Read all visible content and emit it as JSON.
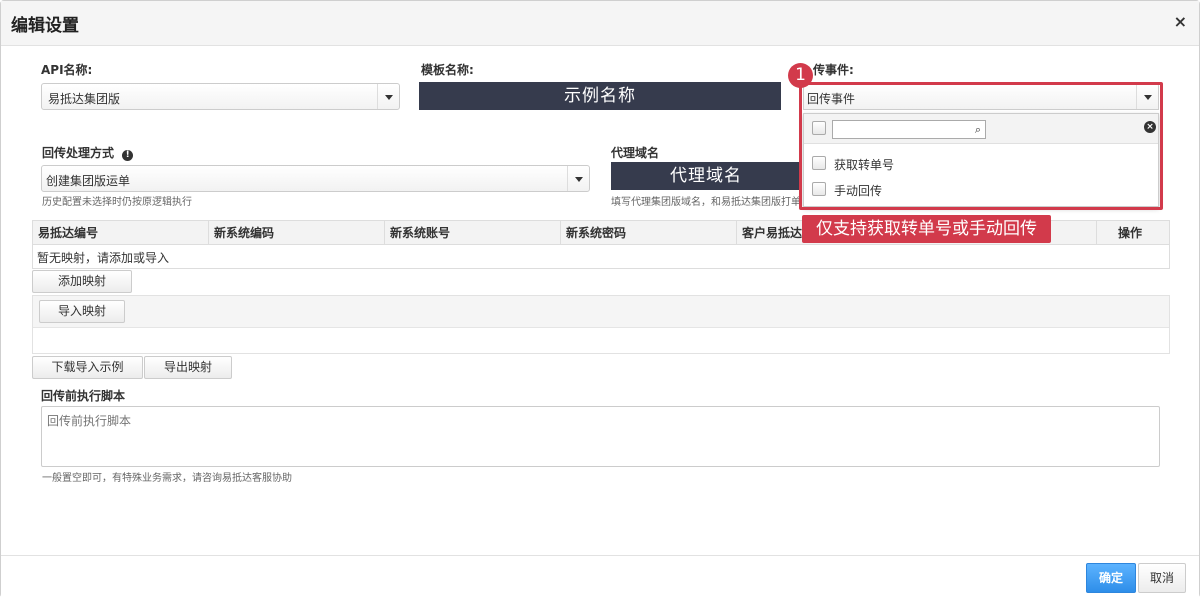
{
  "dialog": {
    "title": "编辑设置",
    "close": "×"
  },
  "api": {
    "label": "API名称:",
    "value": "易抵达集团版"
  },
  "template": {
    "label": "模板名称:",
    "value": "示例名称"
  },
  "event": {
    "label": "传事件:",
    "value": "回传事件",
    "options": [
      "获取转单号",
      "手动回传"
    ],
    "search_icon": "search-icon",
    "clear_icon": "clear-icon"
  },
  "method": {
    "label": "回传处理方式",
    "info_icon": "info-icon",
    "value": "创建集团版运单",
    "hint": "历史配置未选择时仍按原逻辑执行"
  },
  "domain": {
    "label": "代理域名",
    "value": "代理域名",
    "hint": "填写代理集团版域名，和易抵达集团版打单"
  },
  "table": {
    "headers": [
      "易抵达编号",
      "新系统编码",
      "新系统账号",
      "新系统密码",
      "客户易抵达",
      "操作"
    ],
    "empty": "暂无映射，请添加或导入"
  },
  "buttons": {
    "add_mapping": "添加映射",
    "import_mapping": "导入映射",
    "download_sample": "下载导入示例",
    "export_mapping": "导出映射",
    "confirm": "确定",
    "cancel": "取消"
  },
  "script": {
    "label": "回传前执行脚本",
    "placeholder": "回传前执行脚本",
    "hint": "一般置空即可，有特殊业务需求，请咨询易抵达客服协助"
  },
  "annotation": {
    "badge": "1",
    "callout": "仅支持获取转单号或手动回传",
    "color": "#d23a4b"
  }
}
